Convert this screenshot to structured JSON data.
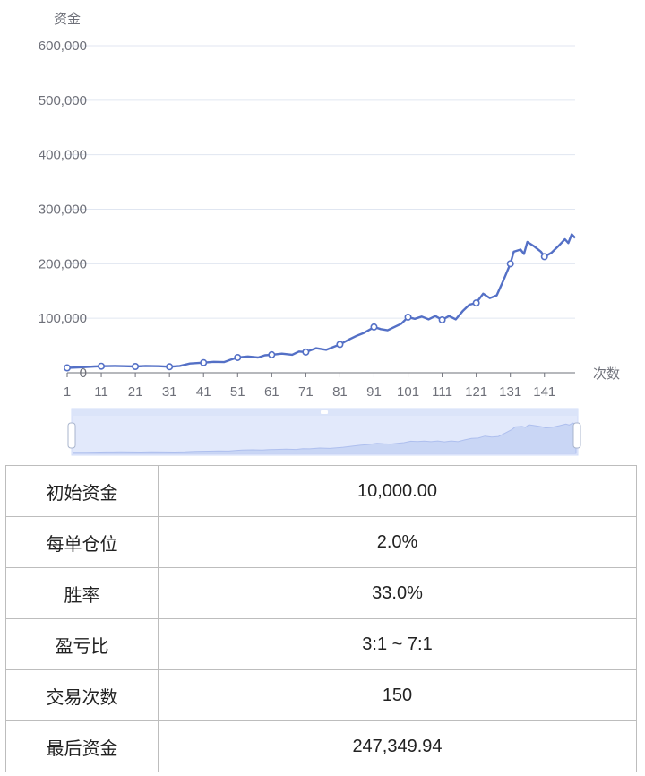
{
  "chart_data": {
    "type": "line",
    "ylabel": "资金",
    "xlabel": "次数",
    "ylim": [
      0,
      600000
    ],
    "y_ticks": [
      "0",
      "100,000",
      "200,000",
      "300,000",
      "400,000",
      "500,000",
      "600,000"
    ],
    "x_ticks": [
      "1",
      "11",
      "21",
      "31",
      "41",
      "51",
      "61",
      "71",
      "81",
      "91",
      "101",
      "111",
      "121",
      "131",
      "141"
    ],
    "x_range": [
      1,
      150
    ],
    "grid": true,
    "datazoom_slider": true,
    "series": [
      {
        "color": "#5470c6",
        "points": [
          [
            1,
            9000
          ],
          [
            5,
            10000
          ],
          [
            9,
            11500
          ],
          [
            11,
            12000
          ],
          [
            15,
            12500
          ],
          [
            18,
            12000
          ],
          [
            21,
            11500
          ],
          [
            24,
            12500
          ],
          [
            28,
            12000
          ],
          [
            31,
            11000
          ],
          [
            34,
            12500
          ],
          [
            37,
            17000
          ],
          [
            41,
            18500
          ],
          [
            44,
            20000
          ],
          [
            47,
            19500
          ],
          [
            49,
            24000
          ],
          [
            51,
            28000
          ],
          [
            54,
            30000
          ],
          [
            57,
            28000
          ],
          [
            59,
            32000
          ],
          [
            61,
            33000
          ],
          [
            64,
            35000
          ],
          [
            67,
            33000
          ],
          [
            69,
            39000
          ],
          [
            71,
            38000
          ],
          [
            74,
            45000
          ],
          [
            77,
            42000
          ],
          [
            79,
            47000
          ],
          [
            81,
            52000
          ],
          [
            84,
            62000
          ],
          [
            86,
            68000
          ],
          [
            88,
            73000
          ],
          [
            90,
            80000
          ],
          [
            91,
            84000
          ],
          [
            93,
            80000
          ],
          [
            95,
            78000
          ],
          [
            97,
            84000
          ],
          [
            99,
            90000
          ],
          [
            101,
            102000
          ],
          [
            103,
            99000
          ],
          [
            105,
            103000
          ],
          [
            107,
            98000
          ],
          [
            109,
            104000
          ],
          [
            111,
            97000
          ],
          [
            113,
            104000
          ],
          [
            115,
            98000
          ],
          [
            117,
            113000
          ],
          [
            119,
            125000
          ],
          [
            121,
            128000
          ],
          [
            123,
            145000
          ],
          [
            125,
            137000
          ],
          [
            127,
            142000
          ],
          [
            129,
            170000
          ],
          [
            131,
            200000
          ],
          [
            132,
            222000
          ],
          [
            134,
            226000
          ],
          [
            135,
            218000
          ],
          [
            136,
            240000
          ],
          [
            138,
            232000
          ],
          [
            140,
            222000
          ],
          [
            141,
            213000
          ],
          [
            143,
            220000
          ],
          [
            145,
            232000
          ],
          [
            147,
            245000
          ],
          [
            148,
            238000
          ],
          [
            149,
            254000
          ],
          [
            150,
            247350
          ]
        ],
        "markers": [
          [
            1,
            9000
          ],
          [
            11,
            12000
          ],
          [
            21,
            11500
          ],
          [
            31,
            11000
          ],
          [
            41,
            18500
          ],
          [
            51,
            28000
          ],
          [
            61,
            33000
          ],
          [
            71,
            38000
          ],
          [
            81,
            52000
          ],
          [
            91,
            84000
          ],
          [
            101,
            102000
          ],
          [
            111,
            97000
          ],
          [
            121,
            128000
          ],
          [
            131,
            200000
          ],
          [
            141,
            213000
          ]
        ]
      }
    ]
  },
  "params_table": [
    {
      "key": "初始资金",
      "value": "10,000.00"
    },
    {
      "key": "每单仓位",
      "value": "2.0%"
    },
    {
      "key": "胜率",
      "value": "33.0%"
    },
    {
      "key": "盈亏比",
      "value": "3:1 ~ 7:1"
    },
    {
      "key": "交易次数",
      "value": "150"
    },
    {
      "key": "最后资金",
      "value": "247,349.94"
    }
  ]
}
